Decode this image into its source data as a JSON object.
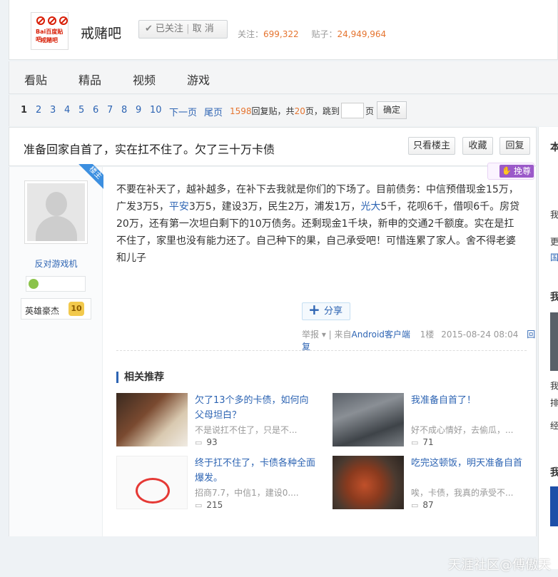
{
  "header": {
    "logo_text": "Bai百度贴吧",
    "logo_name": "戒赌吧",
    "forum_name": "戒赌吧",
    "follow_label": "已关注",
    "unfollow_label": "取 消",
    "members_label": "关注：",
    "members_count": "699,322",
    "posts_label": "贴子：",
    "posts_count": "24,949,964"
  },
  "nav": {
    "items": [
      "看贴",
      "精品",
      "视频",
      "游戏"
    ]
  },
  "pager": {
    "current": "1",
    "pages": [
      "2",
      "3",
      "4",
      "5",
      "6",
      "7",
      "8",
      "9",
      "10"
    ],
    "next": "下一页",
    "last": "尾页",
    "reply_count": "1598",
    "reply_label": "回复贴，共",
    "page_total": "20",
    "page_label": "页，跳到",
    "page_suffix": "页",
    "confirm": "确定"
  },
  "thread": {
    "title": "准备回家自首了，实在扛不住了。欠了三十万卡债",
    "only_op": "只看楼主",
    "favorite": "收藏",
    "reply": "回复"
  },
  "post": {
    "op_badge": "楼主",
    "username": "反对游戏机",
    "level_title": "英雄豪杰",
    "level": "10",
    "huanzun": "挽尊",
    "content_a": "不要在补天了，越补越多，在补下去我就是你们的下场了。目前债务：中信预借现金15万，广发3万5，",
    "link1": "平安",
    "content_b": "3万5，建设3万，民生2万，浦发1万，",
    "link2": "光大",
    "content_c": "5千，花呗6千，借呗6千。房贷20万，还有第一次坦白剩下的10万债务。还剩现金1千块，新申的交通2千额度。实在是扛不住了，家里也没有能力还了。自己种下的果，自己承受吧！可惜连累了家人。舍不得老婆和儿子",
    "share": "分享",
    "report": "举报",
    "source_prefix": "| 来自",
    "source": "Android客户端",
    "floor": "1楼",
    "time": "2015-08-24 08:04",
    "reply": "回复"
  },
  "related": {
    "heading": "相关推荐",
    "items": [
      {
        "title": "欠了13个多的卡债，如何向父母坦白？",
        "desc": "不是说扛不住了，只是不...",
        "comments": "93"
      },
      {
        "title": "我准备自首了！",
        "desc": "好不成心情好，去偷瓜，...",
        "comments": "71"
      },
      {
        "title": "终于扛不住了，卡债各种全面爆发。",
        "desc": "招商7.7，中信1，建设0....",
        "comments": "215"
      },
      {
        "title": "吃完这顿饭，明天准备自首",
        "desc": "唉，卡债，我真的承受不...",
        "comments": "87"
      }
    ]
  },
  "right": {
    "chars": [
      "本",
      "我",
      "更",
      "国",
      "我",
      "我",
      "排",
      "经",
      "我"
    ]
  },
  "watermark": "天涯社区@傅傲天",
  "colors": {
    "link": "#2d64b3",
    "accent": "#e5742f",
    "op_badge": "#3c8fe0",
    "huanzun": "#9b59c9"
  }
}
